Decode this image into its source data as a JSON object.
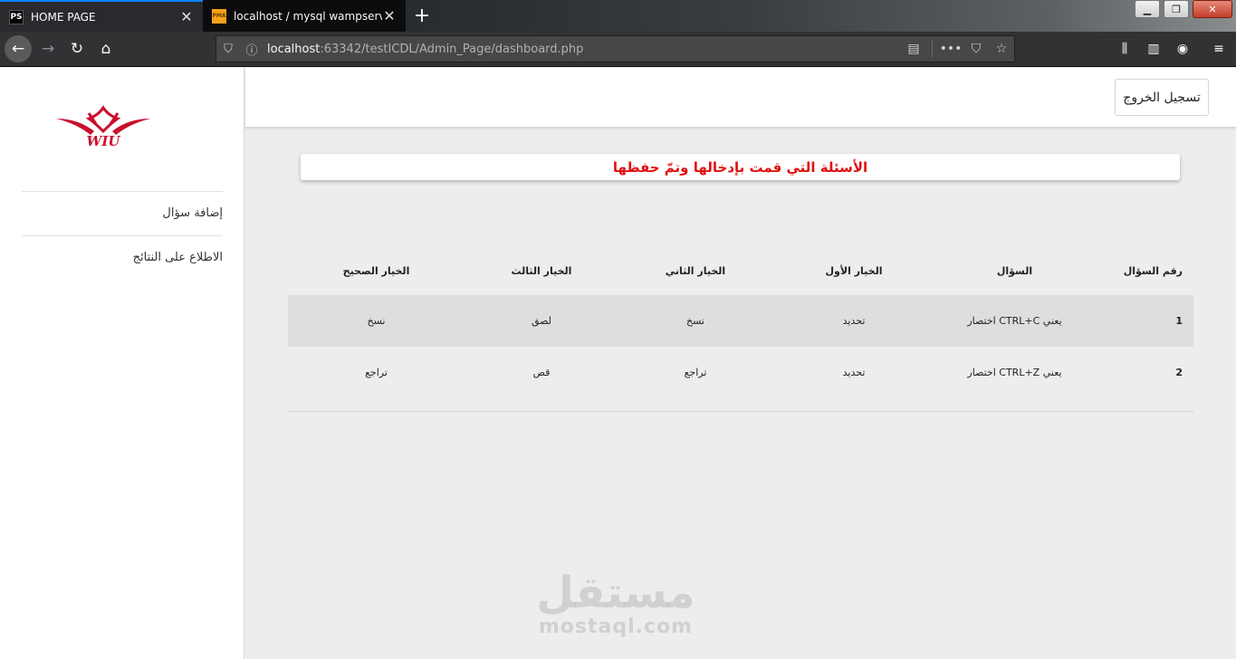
{
  "browser": {
    "tabs": [
      {
        "favicon": "PS",
        "title": "HOME PAGE",
        "active": true
      },
      {
        "favicon": "PMA",
        "title": "localhost / mysql wampserver /",
        "active": false
      }
    ],
    "url_host": "localhost",
    "url_rest": ":63342/testICDL/Admin_Page/dashboard.php",
    "icons": [
      "back-icon",
      "forward-icon",
      "reload-icon",
      "home-icon",
      "shield-icon",
      "info-icon",
      "reader-view-icon",
      "more-icon",
      "pocket-icon",
      "star-icon",
      "library-icon",
      "sidebar-icon",
      "account-icon",
      "menu-icon"
    ]
  },
  "sidebar": {
    "logo_text": "WIU",
    "items": [
      {
        "label": "إضافة سؤال"
      },
      {
        "label": "الاطلاع على النتائج"
      }
    ]
  },
  "header": {
    "logout_label": "تسجيل الخروج"
  },
  "banner": {
    "title": "الأسئلة التي قمت بإدخالها وتمّ حفظها",
    "color": "#e01010"
  },
  "table": {
    "headers": [
      "رقم السؤال",
      "السؤال",
      "الخيار الأول",
      "الخيار الثاني",
      "الخيار الثالث",
      "الخيار الصحيح"
    ],
    "rows": [
      {
        "num": "1",
        "question": "يعني CTRL+C اختصار",
        "opt1": "تحديد",
        "opt2": "نسخ",
        "opt3": "لصق",
        "correct": "نسخ"
      },
      {
        "num": "2",
        "question": "يعني CTRL+Z اختصار",
        "opt1": "تحديد",
        "opt2": "تراجع",
        "opt3": "قص",
        "correct": "تراجع"
      }
    ]
  },
  "watermark": {
    "arabic": "مستقل",
    "latin": "mostaql.com"
  }
}
